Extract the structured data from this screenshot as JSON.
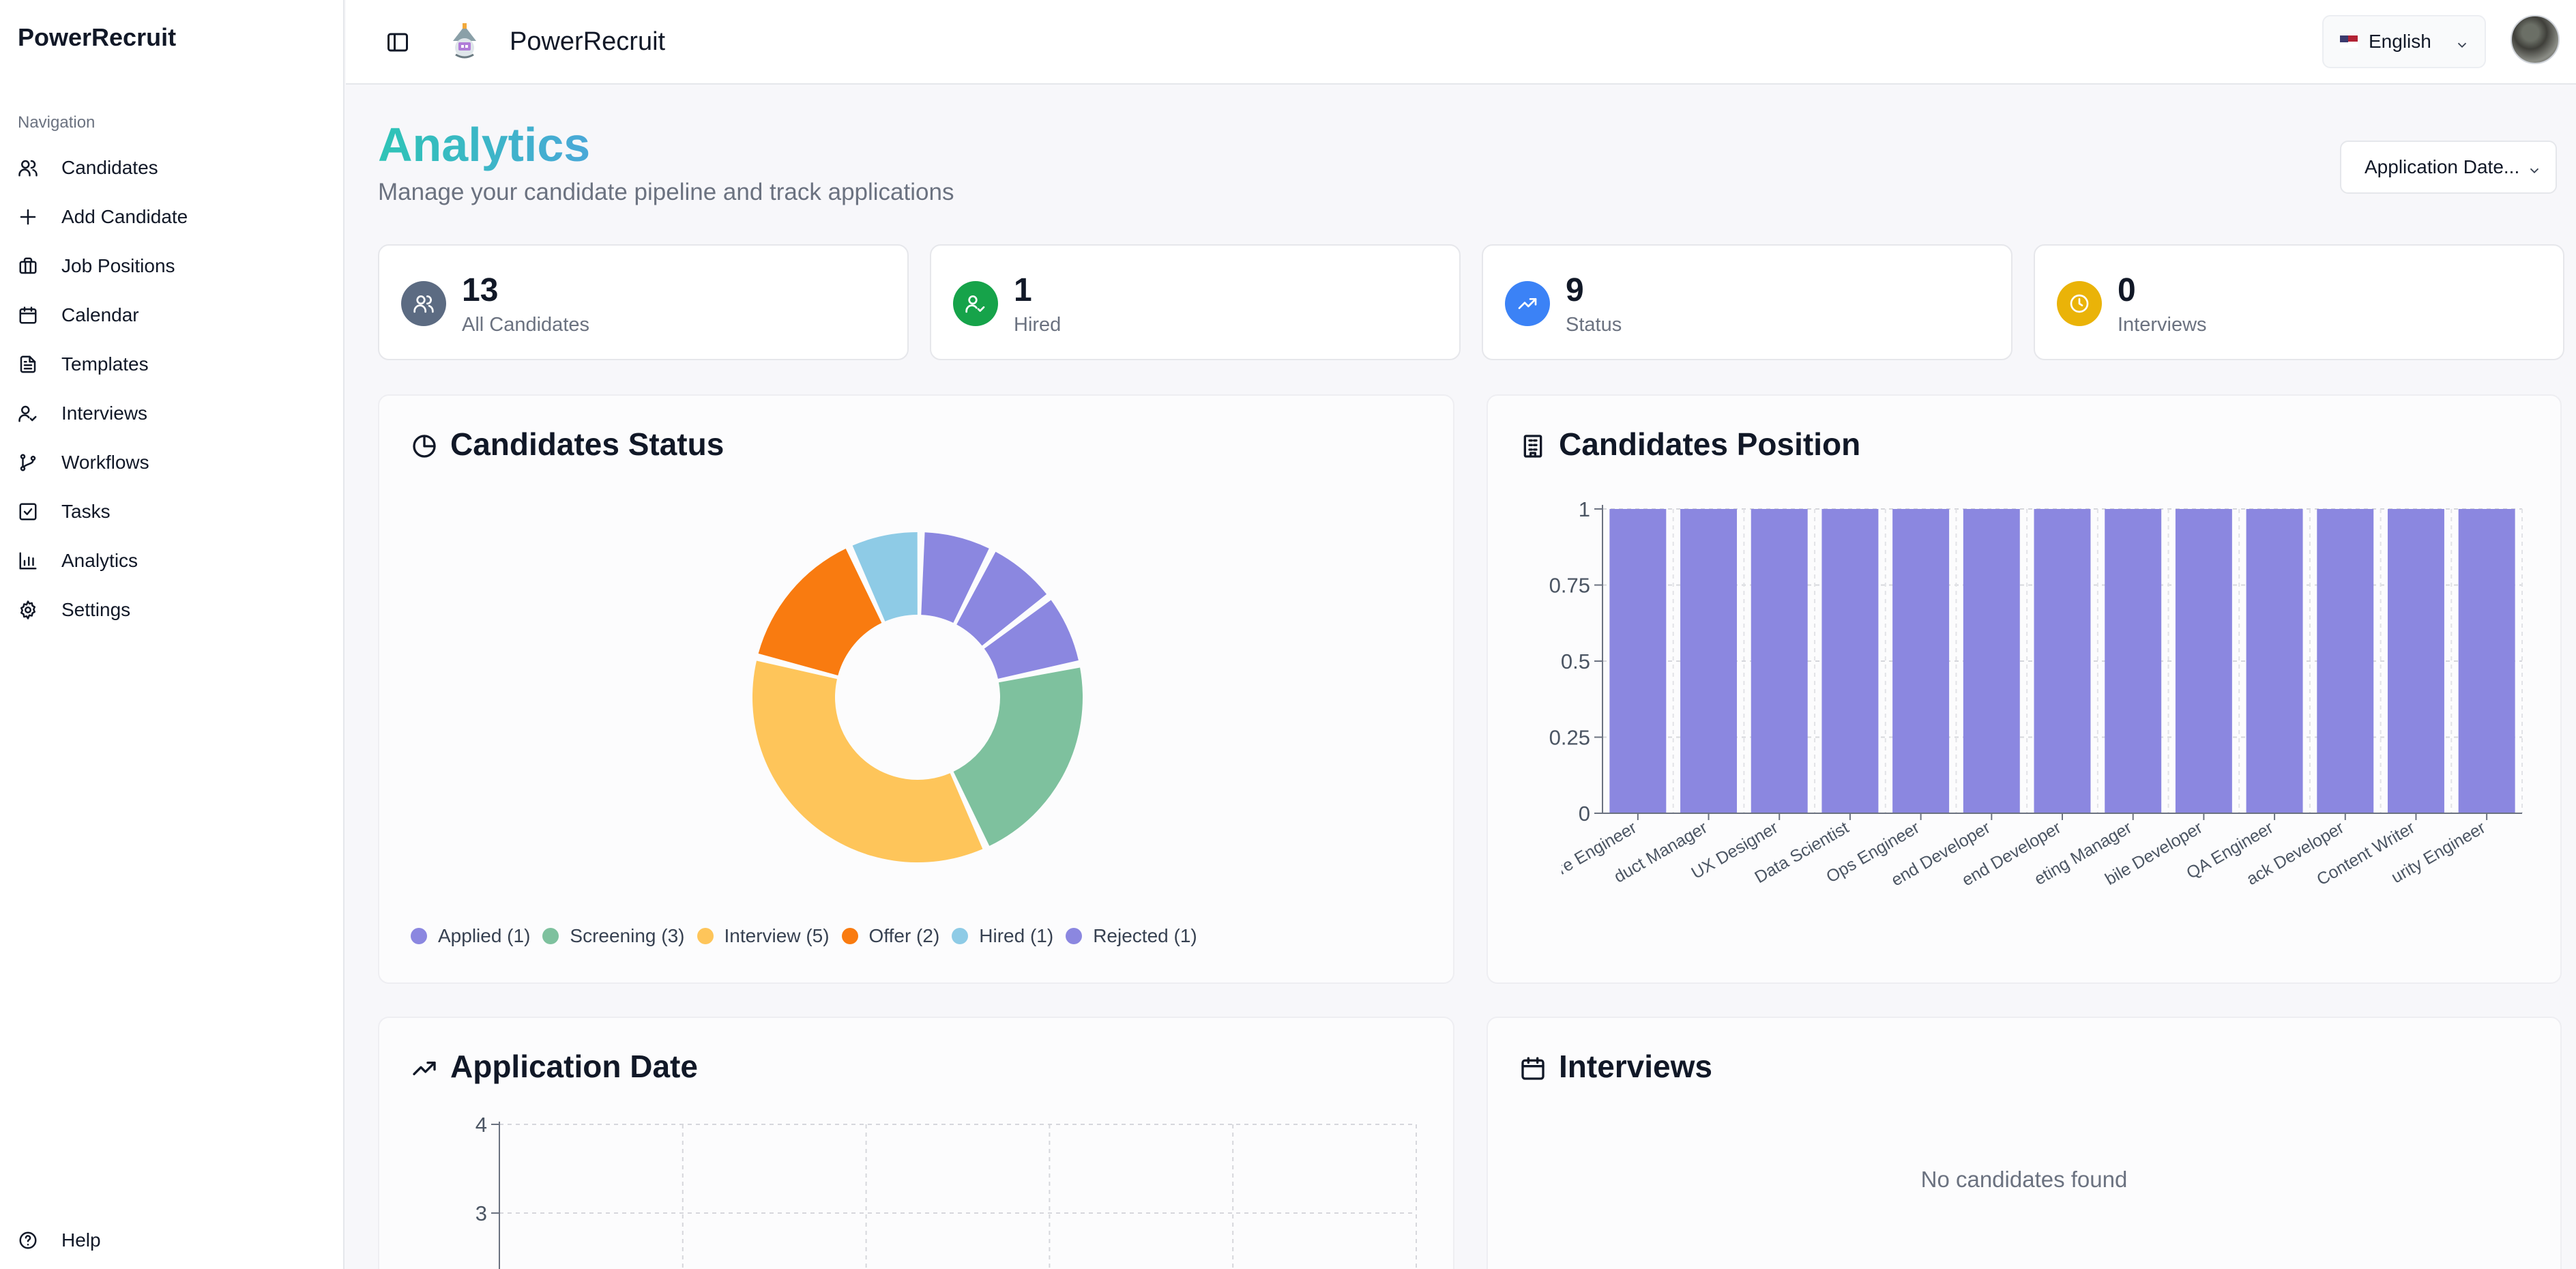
{
  "sidebar": {
    "brand": "PowerRecruit",
    "nav_title": "Navigation",
    "items": [
      {
        "label": "Candidates",
        "icon": "users-icon"
      },
      {
        "label": "Add Candidate",
        "icon": "plus-icon"
      },
      {
        "label": "Job Positions",
        "icon": "briefcase-icon"
      },
      {
        "label": "Calendar",
        "icon": "calendar-icon"
      },
      {
        "label": "Templates",
        "icon": "file-text-icon"
      },
      {
        "label": "Interviews",
        "icon": "user-check-icon"
      },
      {
        "label": "Workflows",
        "icon": "git-branch-icon"
      },
      {
        "label": "Tasks",
        "icon": "check-square-icon"
      },
      {
        "label": "Analytics",
        "icon": "bar-chart-icon"
      },
      {
        "label": "Settings",
        "icon": "gear-icon"
      }
    ],
    "help_label": "Help"
  },
  "header": {
    "title": "PowerRecruit",
    "language": "English"
  },
  "main": {
    "title": "Analytics",
    "subtitle": "Manage your candidate pipeline and track applications",
    "filter_label": "Application Date..."
  },
  "stats": [
    {
      "value": "13",
      "label": "All Candidates",
      "color": "#5c6b82"
    },
    {
      "value": "1",
      "label": "Hired",
      "color": "#16a34a"
    },
    {
      "value": "9",
      "label": "Status",
      "color": "#3b82f6"
    },
    {
      "value": "0",
      "label": "Interviews",
      "color": "#eab308"
    }
  ],
  "cards": {
    "status_title": "Candidates Status",
    "position_title": "Candidates Position",
    "appdate_title": "Application Date",
    "interviews_title": "Interviews",
    "interviews_empty": "No candidates found"
  },
  "chart_data": [
    {
      "type": "pie",
      "title": "Candidates Status",
      "categories": [
        "Applied",
        "Applied",
        "Screening",
        "Interview",
        "Offer",
        "Hired",
        "Rejected"
      ],
      "values": [
        1,
        1,
        3,
        5,
        2,
        1,
        1
      ],
      "colors": [
        "#8b87e0",
        "#8b87e0",
        "#7ec19e",
        "#fec55a",
        "#f97b10",
        "#8ecbe6",
        "#8b87e0"
      ],
      "legend": [
        {
          "label": "Applied (1)",
          "color": "#8b87e0"
        },
        {
          "label": "Screening (3)",
          "color": "#7ec19e"
        },
        {
          "label": "Interview (5)",
          "color": "#fec55a"
        },
        {
          "label": "Offer (2)",
          "color": "#f97b10"
        },
        {
          "label": "Hired (1)",
          "color": "#8ecbe6"
        },
        {
          "label": "Rejected (1)",
          "color": "#8b87e0"
        }
      ]
    },
    {
      "type": "bar",
      "title": "Candidates Position",
      "categories": [
        "ware Engineer",
        "duct Manager",
        "UX Designer",
        "Data Scientist",
        "Ops Engineer",
        "end Developer",
        "end Developer",
        "eting Manager",
        "bile Developer",
        "QA Engineer",
        "ack Developer",
        "Content Writer",
        "urity Engineer"
      ],
      "values": [
        1,
        1,
        1,
        1,
        1,
        1,
        1,
        1,
        1,
        1,
        1,
        1,
        1
      ],
      "yticks": [
        "0",
        "0.25",
        "0.5",
        "0.75",
        "1"
      ],
      "ylim": [
        0,
        1
      ],
      "color": "#8b87e0"
    },
    {
      "type": "line",
      "title": "Application Date",
      "yticks": [
        "3",
        "4"
      ],
      "grid": true
    }
  ]
}
